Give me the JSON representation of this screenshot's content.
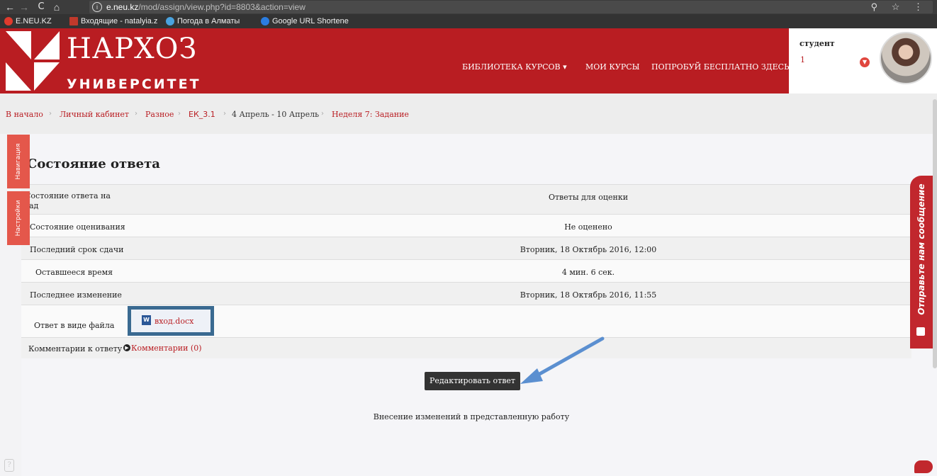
{
  "browser": {
    "url_host": "e.neu.kz",
    "url_path": "/mod/assign/view.php?id=8803&action=view",
    "back_icon": "←",
    "forward_icon": "→",
    "reload_icon": "C",
    "home_icon": "⌂",
    "info_icon": "i",
    "right_icons": "⚲ ☆ ⋮"
  },
  "bookmarks": [
    {
      "label": "E.NEU.KZ",
      "color": "#e03b2d"
    },
    {
      "label": "Входящие - natalyia.z",
      "color": "#c0392b"
    },
    {
      "label": "Погода в Алматы",
      "color": "#4aa3df"
    },
    {
      "label": "Google URL Shortene",
      "color": "#2a7de1"
    }
  ],
  "header": {
    "logo_title": "НАРХОЗ",
    "logo_subtitle": "УНИВЕРСИТЕТ",
    "nav": {
      "library": "БИБЛИОТЕКА КУРСОВ ▾",
      "my_courses": "МОИ КУРСЫ",
      "try_free": "ПОПРОБУЙ БЕСПЛАТНО ЗДЕСЬ!"
    },
    "user": {
      "role": "студент",
      "number": "1"
    }
  },
  "breadcrumb": {
    "home": "В начало",
    "cabinet": "Личный кабинет",
    "misc": "Разное",
    "course": "ЕК_3.1",
    "period": "4 Апрель - 10 Апрель",
    "task": "Неделя 7: Задание",
    "separator": "›"
  },
  "side_tabs": {
    "navigation": "Навигация",
    "settings": "Настройки"
  },
  "main": {
    "title": "Состояние ответа",
    "rows": {
      "submission_status_label": "Состояние ответа на зад\nание",
      "submission_status_value": "Ответы для оценки",
      "grading_status_label": "Состояние оценивания",
      "grading_status_value": "Не оценено",
      "due_date_label": "Последний срок сдачи",
      "due_date_value": "Вторник, 18 Октябрь 2016, 12:00",
      "time_left_label": "Оставшееся время",
      "time_left_value": "4 мин. 6 сек.",
      "modified_label": "Последнее изменение",
      "modified_value": "Вторник, 18 Октябрь 2016, 11:55",
      "file_label": "Ответ в виде файла",
      "file_name": "вход.docx",
      "comments_label": "Комментарии к ответу",
      "comments_link": "Комментарии (0)"
    },
    "edit_button": "Редактировать ответ",
    "edit_note": "Внесение изменений в представленную работу"
  },
  "feedback_tab": "Отправьте нам сообщение",
  "colors": {
    "brand": "#b91d22",
    "accent": "#e4574b",
    "highlight_box": "#3a6a91",
    "arrow": "#5b8fd0"
  }
}
